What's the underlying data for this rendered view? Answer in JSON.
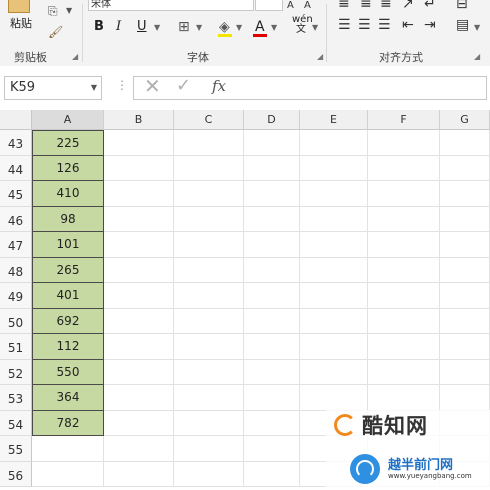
{
  "ribbon": {
    "clipboard": {
      "paste_label": "粘贴",
      "group_label": "剪贴板"
    },
    "font": {
      "font_name": "宋体",
      "group_label": "字体",
      "bold": "B",
      "italic": "I",
      "underline": "U",
      "phonetic": "wén文"
    },
    "alignment": {
      "group_label": "对齐方式"
    }
  },
  "formula_bar": {
    "name_box": "K59",
    "fx": "fx",
    "formula": ""
  },
  "columns": [
    "A",
    "B",
    "C",
    "D",
    "E",
    "F",
    "G"
  ],
  "rows": [
    {
      "num": "43",
      "a": "225"
    },
    {
      "num": "44",
      "a": "126"
    },
    {
      "num": "45",
      "a": "410"
    },
    {
      "num": "46",
      "a": "98"
    },
    {
      "num": "47",
      "a": "101"
    },
    {
      "num": "48",
      "a": "265"
    },
    {
      "num": "49",
      "a": "401"
    },
    {
      "num": "50",
      "a": "692"
    },
    {
      "num": "51",
      "a": "112"
    },
    {
      "num": "52",
      "a": "550"
    },
    {
      "num": "53",
      "a": "364"
    },
    {
      "num": "54",
      "a": "782"
    },
    {
      "num": "55",
      "a": ""
    },
    {
      "num": "56",
      "a": ""
    }
  ],
  "watermark": {
    "title": "酷知网",
    "subtitle": "越半前门网",
    "url": "www.yueyangbang.com"
  },
  "colors": {
    "data_fill": "#c6d9a3",
    "accent_orange": "#f08a1c",
    "accent_blue": "#2f8fe0"
  }
}
